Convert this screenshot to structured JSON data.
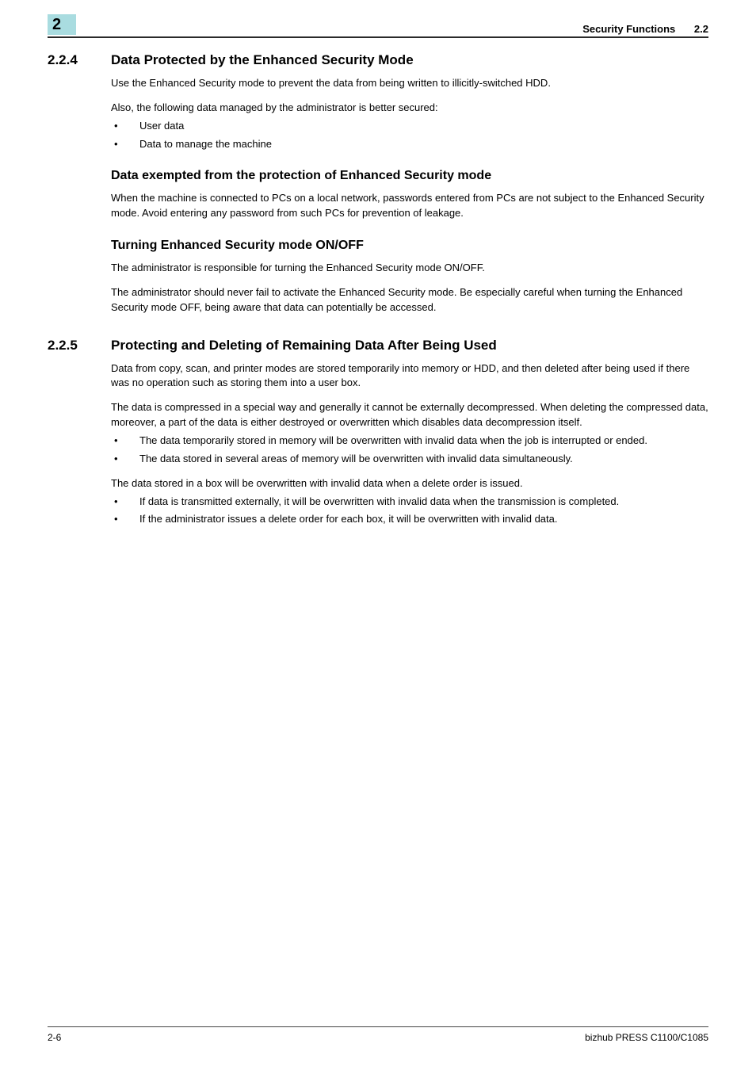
{
  "header": {
    "chapter_number": "2",
    "running_title": "Security Functions",
    "running_section": "2.2"
  },
  "section_224": {
    "number": "2.2.4",
    "title": "Data Protected by the Enhanced Security Mode",
    "p1": "Use the Enhanced Security mode to prevent the data from being written to illicitly-switched HDD.",
    "p2": "Also, the following data managed by the administrator is better secured:",
    "bullets": {
      "b1": "User data",
      "b2": "Data to manage the machine"
    },
    "sub1": {
      "title": "Data exempted from the protection of Enhanced Security mode",
      "p1": "When the machine is connected to PCs on a local network, passwords entered from PCs are not subject to the Enhanced Security mode. Avoid entering any password from such PCs for prevention of leakage."
    },
    "sub2": {
      "title": "Turning Enhanced Security mode ON/OFF",
      "p1": "The administrator is responsible for turning the Enhanced Security mode ON/OFF.",
      "p2": "The administrator should never fail to activate the Enhanced Security mode. Be especially careful when turning the Enhanced Security mode OFF, being aware that data can potentially be accessed."
    }
  },
  "section_225": {
    "number": "2.2.5",
    "title": "Protecting and Deleting of Remaining Data After Being Used",
    "p1": "Data from copy, scan, and printer modes are stored temporarily into memory or HDD, and then deleted after being used if there was no operation such as storing them into a user box.",
    "p2": "The data is compressed in a special way and generally it cannot be externally decompressed. When deleting the compressed data, moreover, a part of the data is either destroyed or overwritten which disables data decompression itself.",
    "bullets1": {
      "b1": "The data temporarily stored in memory will be overwritten with invalid data when the job is interrupted or ended.",
      "b2": "The data stored in several areas of memory will be overwritten with invalid data simultaneously."
    },
    "p3": "The data stored in a box will be overwritten with invalid data when a delete order is issued.",
    "bullets2": {
      "b1": "If data is transmitted externally, it will be overwritten with invalid data when the transmission is completed.",
      "b2": "If the administrator issues a delete order for each box, it will be overwritten with invalid data."
    }
  },
  "footer": {
    "page": "2-6",
    "product": "bizhub PRESS C1100/C1085"
  }
}
